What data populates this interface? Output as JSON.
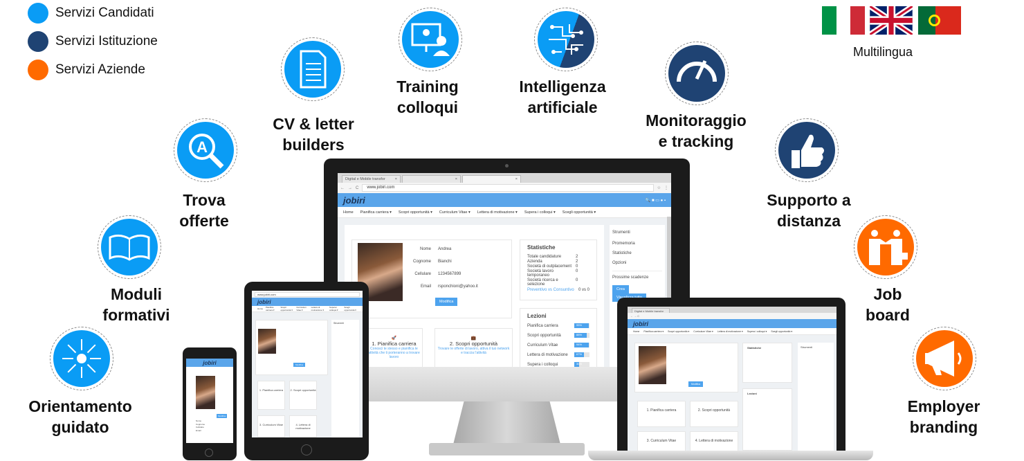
{
  "legend": [
    {
      "label": "Servizi Candidati",
      "color": "#0a9cf5"
    },
    {
      "label": "Servizi Istituzione",
      "color": "#1f4373"
    },
    {
      "label": "Servizi Aziende",
      "color": "#ff6a00"
    }
  ],
  "languages": {
    "label": "Multilingua",
    "flags": [
      "italy-flag",
      "uk-flag",
      "portugal-flag"
    ]
  },
  "features": [
    {
      "line1": "Orientamento",
      "line2": "guidato",
      "color": "#0a9cf5",
      "icon": "compass-arrows-icon"
    },
    {
      "line1": "Moduli",
      "line2": "formativi",
      "color": "#0a9cf5",
      "icon": "book-icon"
    },
    {
      "line1": "Trova",
      "line2": "offerte",
      "color": "#0a9cf5",
      "icon": "search-icon"
    },
    {
      "line1": "CV & letter",
      "line2": "builders",
      "color": "#0a9cf5",
      "icon": "document-icon"
    },
    {
      "line1": "Training",
      "line2": "colloqui",
      "color": "#0a9cf5",
      "icon": "video-interview-icon"
    },
    {
      "line1": "Intelligenza",
      "line2": "artificiale",
      "color": "#1f4373",
      "icon": "circuit-brain-icon"
    },
    {
      "line1": "Monitoraggio",
      "line2": "e tracking",
      "color": "#1f4373",
      "icon": "gauge-icon"
    },
    {
      "line1": "Supporto a",
      "line2": "distanza",
      "color": "#1f4373",
      "icon": "thumbs-up-icon"
    },
    {
      "line1": "Job",
      "line2": "board",
      "color": "#ff6a00",
      "icon": "handshake-icon"
    },
    {
      "line1": "Employer",
      "line2": "branding",
      "color": "#ff6a00",
      "icon": "megaphone-icon"
    }
  ],
  "app": {
    "tab1": "Digital e Mobile transfor",
    "url": "www.jobiri.com",
    "logo": "jobiri",
    "nav": [
      "Home",
      "Pianifica carriera ▾",
      "Scopri opportunità ▾",
      "Curriculum Vitae ▾",
      "Lettera di motivazione ▾",
      "Supera i colloqui ▾",
      "Scegli opportunità ▾"
    ],
    "profile": [
      {
        "k": "Nome",
        "v": "Andrea"
      },
      {
        "k": "Cognome",
        "v": "Bianchi"
      },
      {
        "k": "Cellulare",
        "v": "1234567899"
      },
      {
        "k": "Email",
        "v": "rsponchioni@yahoo.it"
      }
    ],
    "edit_button": "Modifica",
    "stats_title": "Statistiche",
    "stats": [
      {
        "k": "Totale candidature",
        "v": "2"
      },
      {
        "k": "Azienda",
        "v": "2"
      },
      {
        "k": "Società di outplacement",
        "v": "0"
      },
      {
        "k": "Società lavoro temporaneo",
        "v": "0"
      },
      {
        "k": "Società ricerca e selezione",
        "v": "0"
      }
    ],
    "stats_link": "Preventivo vs Consuntivo",
    "stats_link_value": "0 vs 0",
    "lessons_title": "Lezioni",
    "lessons": [
      {
        "k": "Pianifica carriera",
        "v": "95%",
        "pct": 95
      },
      {
        "k": "Scopri opportunità",
        "v": "88%",
        "pct": 80
      },
      {
        "k": "Curriculum Vitae",
        "v": "94%",
        "pct": 94
      },
      {
        "k": "Lettera di motivazione",
        "v": "67%",
        "pct": 62
      },
      {
        "k": "Supera i colloqui",
        "v": "30%",
        "pct": 30
      }
    ],
    "steps": [
      {
        "title": "1. Pianifica carriera",
        "text": "Conosci te stesso e pianifica le attività che ti porteranno a trovare lavoro"
      },
      {
        "title": "2. Scopri opportunità",
        "text": "Trovare le offerte di lavoro, attiva il tuo network e traccia l'attività"
      },
      {
        "title": "3. Curriculum Vitae",
        "text": ""
      },
      {
        "title": "4. Lettera di motivazione",
        "text": ""
      }
    ],
    "sidebar": {
      "tools": "Strumenti",
      "items": [
        "Promemoria",
        "Statistiche",
        "Opzioni"
      ],
      "deadlines": "Prossime scadenze",
      "create": "Crea",
      "view_all": "Visualizza tutto"
    }
  }
}
